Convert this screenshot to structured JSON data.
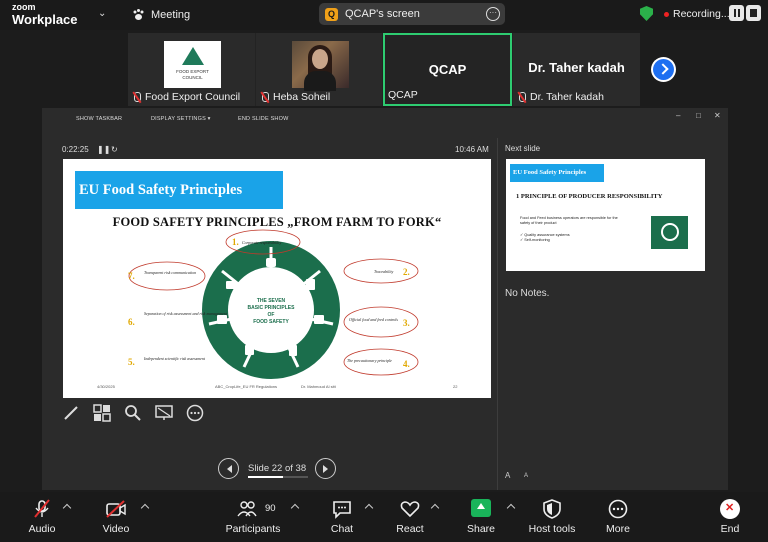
{
  "app": {
    "brand_small": "zoom",
    "brand_big": "Workplace",
    "meeting_label": "Meeting"
  },
  "screen_share": {
    "label": "QCAP's screen",
    "icon_letter": "Q"
  },
  "recording": {
    "label": "Recording..."
  },
  "participants": [
    {
      "name": "Food Export Council",
      "logo_text": "FOOD EXPORT COUNCIL"
    },
    {
      "name": "Heba Soheil"
    },
    {
      "name": "QCAP",
      "display": "QCAP"
    },
    {
      "name": "Dr. Taher kadah",
      "display": "Dr. Taher kadah"
    }
  ],
  "presenter": {
    "menu": {
      "taskbar": "SHOW TASKBAR",
      "display": "DISPLAY SETTINGS ▾",
      "end": "END SLIDE SHOW"
    },
    "timer": "0:22:25",
    "clock": "10:46 AM",
    "next_label": "Next slide",
    "notes": "No Notes.",
    "slide_counter": "Slide 22 of 38",
    "slide_progress": 0.58,
    "font_up": "A",
    "font_down": "A"
  },
  "slide": {
    "title": "EU Food Safety Principles",
    "heading": "FOOD SAFETY PRINCIPLES „FROM FARM TO FORK“",
    "center_text": [
      "THE SEVEN",
      "BASIC PRINCIPLES",
      "OF",
      "FOOD SAFETY"
    ],
    "principles": [
      {
        "num": "1.",
        "text": "Corporate responsibility"
      },
      {
        "num": "2.",
        "text": "Traceability"
      },
      {
        "num": "3.",
        "text": "Official food and feed controls"
      },
      {
        "num": "4.",
        "text": "The precautionary principle"
      },
      {
        "num": "5.",
        "text": "Independent scientific risk assessment"
      },
      {
        "num": "6.",
        "text": "Separation of risk assessment and risk management"
      },
      {
        "num": "7.",
        "text": "Transparent risk communication"
      }
    ],
    "footer_date": "4/30/2025",
    "footer_mid": "ABC_CropLife_EU FR Regulations",
    "footer_author": "Dr. Mahmoud Al sitt",
    "footer_page": "22"
  },
  "next_slide": {
    "title": "EU Food Safety Principles",
    "heading": "1 PRINCIPLE OF PRODUCER RESPONSIBILITY",
    "bullets": [
      "Food and Feed business operators are responsible for the safety of their product",
      "✓ Quality assurance systems",
      "✓ Self-monitoring"
    ]
  },
  "toolbar": {
    "audio": "Audio",
    "video": "Video",
    "participants": "Participants",
    "participant_count": "90",
    "chat": "Chat",
    "react": "React",
    "share": "Share",
    "host_tools": "Host tools",
    "more": "More",
    "end": "End"
  },
  "colors": {
    "accent_green": "#2ecc71",
    "slide_title_blue": "#1aa3e8",
    "wheel_green": "#1b6e4c",
    "end_red": "#e02020"
  }
}
